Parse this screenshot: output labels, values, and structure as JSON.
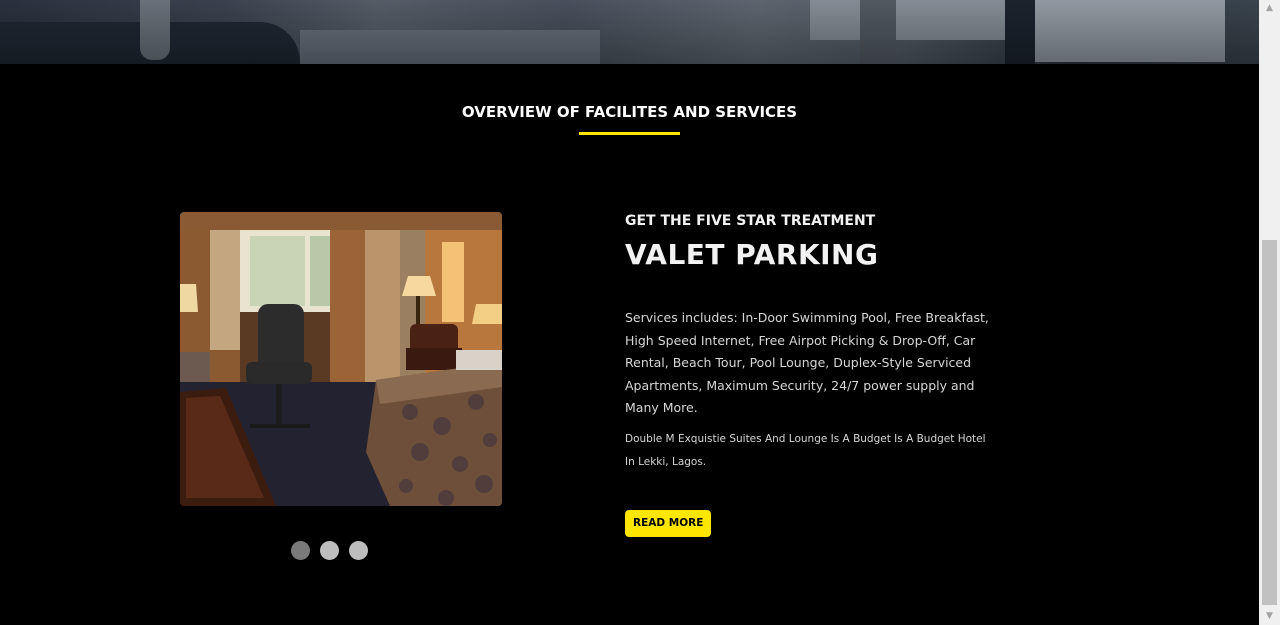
{
  "section": {
    "title": "OVERVIEW OF FACILITES AND SERVICES",
    "accent_color": "#ffe600"
  },
  "slide": {
    "subtitle": "GET THE FIVE STAR TREATMENT",
    "headline": "VALET PARKING",
    "services": "Services includes: In-Door Swimming Pool, Free Breakfast, High Speed Internet, Free Airpot Picking & Drop-Off, Car Rental, Beach Tour, Pool Lounge, Duplex-Style Serviced Apartments, Maximum Security, 24/7 power supply and Many More.",
    "tagline": "Double M Exquistie Suites And Lounge Is A Budget Is A Budget Hotel In Lekki, Lagos.",
    "button_label": "READ MORE",
    "image_icon": "hotel-room-photo"
  },
  "carousel": {
    "dot_count": 3,
    "active_index": 0
  },
  "scrollbar": {
    "up_icon": "chevron-up-icon",
    "down_icon": "chevron-down-icon",
    "up_glyph": "▲",
    "down_glyph": "▼"
  }
}
